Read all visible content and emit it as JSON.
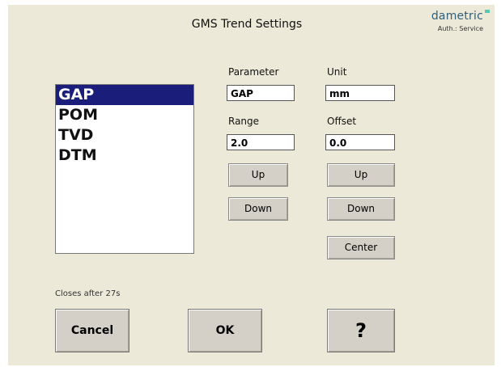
{
  "header": {
    "title": "GMS Trend Settings",
    "brand": "dametric",
    "auth": "Auth.: Service"
  },
  "list": {
    "items": [
      "GAP",
      "POM",
      "TVD",
      "DTM"
    ],
    "selected": "GAP"
  },
  "parameter": {
    "label": "Parameter",
    "value": "GAP"
  },
  "unit": {
    "label": "Unit",
    "value": "mm"
  },
  "range": {
    "label": "Range",
    "value": "2.0",
    "up": "Up",
    "down": "Down"
  },
  "offset": {
    "label": "Offset",
    "value": "0.0",
    "up": "Up",
    "down": "Down",
    "center": "Center"
  },
  "status": {
    "closes": "Closes after 27s"
  },
  "footer": {
    "cancel": "Cancel",
    "ok": "OK",
    "help": "?"
  },
  "colors": {
    "selection": "#1a1e7a",
    "panel": "#ece9d8",
    "button": "#d4d0c8",
    "brand": "#2f5d7a",
    "brand_mark": "#58c8b0"
  }
}
